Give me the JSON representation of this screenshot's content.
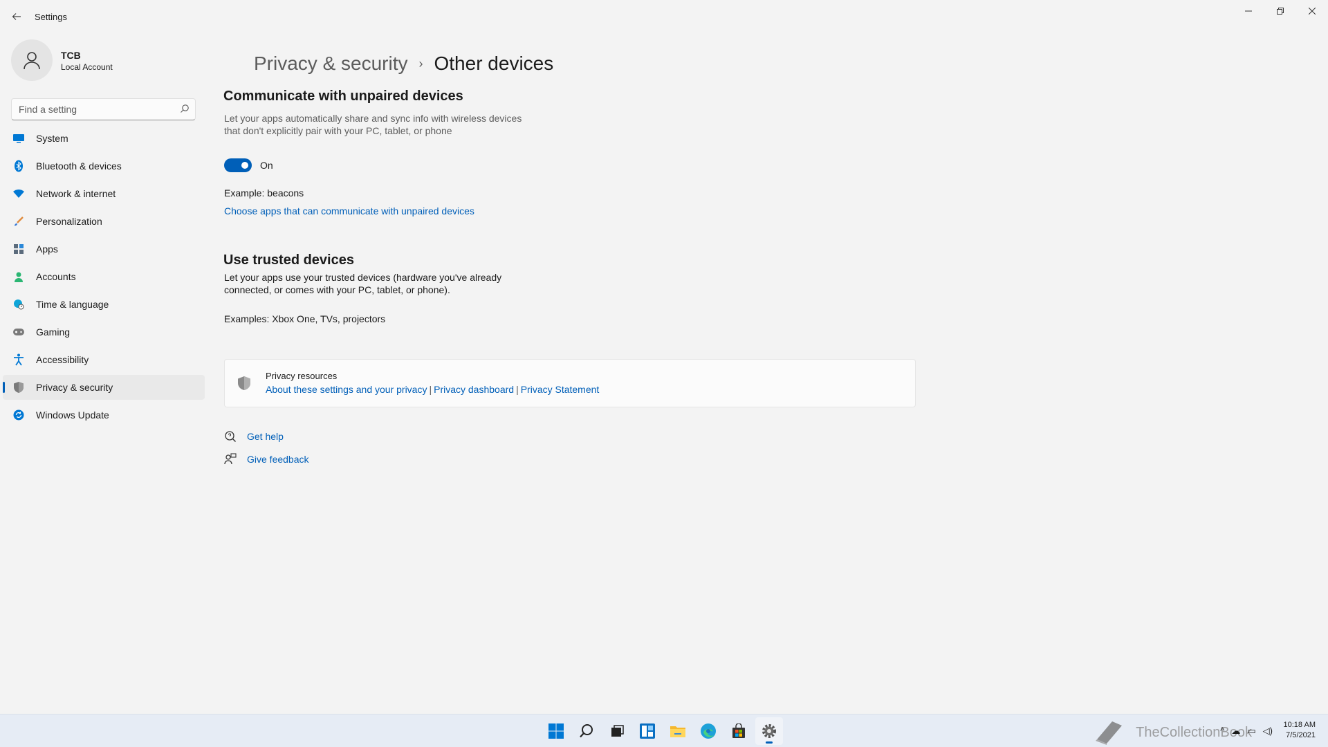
{
  "window": {
    "title": "Settings",
    "back_icon": "back-arrow-icon",
    "controls": {
      "minimize": "minimize-icon",
      "maximize": "restore-icon",
      "close": "close-icon"
    }
  },
  "user": {
    "name": "TCB",
    "account_type": "Local Account"
  },
  "search": {
    "placeholder": "Find a setting",
    "value": ""
  },
  "sidebar": {
    "items": [
      {
        "label": "System",
        "icon": "monitor-icon",
        "color": "#0078d4"
      },
      {
        "label": "Bluetooth & devices",
        "icon": "bluetooth-icon",
        "color": "#0078d4"
      },
      {
        "label": "Network & internet",
        "icon": "wifi-icon",
        "color": "#0078d4"
      },
      {
        "label": "Personalization",
        "icon": "brush-icon",
        "color": "#e08a3c"
      },
      {
        "label": "Apps",
        "icon": "apps-icon",
        "color": "#5b6b7c"
      },
      {
        "label": "Accounts",
        "icon": "person-icon",
        "color": "#2bb673"
      },
      {
        "label": "Time & language",
        "icon": "globe-clock-icon",
        "color": "#0ea5d8"
      },
      {
        "label": "Gaming",
        "icon": "gamepad-icon",
        "color": "#7a7a7a"
      },
      {
        "label": "Accessibility",
        "icon": "accessibility-icon",
        "color": "#0078d4"
      },
      {
        "label": "Privacy & security",
        "icon": "shield-icon",
        "color": "#7a7a7a",
        "active": true
      },
      {
        "label": "Windows Update",
        "icon": "update-icon",
        "color": "#0078d4"
      }
    ]
  },
  "breadcrumb": {
    "parent": "Privacy & security",
    "separator": "›",
    "current": "Other devices"
  },
  "section1": {
    "title": "Communicate with unpaired devices",
    "description": "Let your apps automatically share and sync info with wireless devices that don't explicitly pair with your PC, tablet, or phone",
    "toggle_state": "On",
    "example": "Example: beacons",
    "link": "Choose apps that can communicate with unpaired devices"
  },
  "section2": {
    "title": "Use trusted devices",
    "description": "Let your apps use your trusted devices (hardware you've already connected, or comes with your PC, tablet, or phone).",
    "examples": "Examples: Xbox One, TVs, projectors"
  },
  "privacy_resources": {
    "title": "Privacy resources",
    "links": [
      "About these settings and your privacy",
      "Privacy dashboard",
      "Privacy Statement"
    ],
    "separator": "|"
  },
  "help": {
    "get_help": "Get help",
    "give_feedback": "Give feedback"
  },
  "taskbar": {
    "apps": [
      "windows-start-icon",
      "search-icon",
      "task-view-icon",
      "widgets-icon",
      "file-explorer-icon",
      "edge-icon",
      "store-icon",
      "settings-icon"
    ],
    "watermark": "TheCollectionBook",
    "time": "10:18 AM",
    "date": "7/5/2021"
  },
  "colors": {
    "accent": "#005fb8",
    "background": "#f3f3f3"
  }
}
